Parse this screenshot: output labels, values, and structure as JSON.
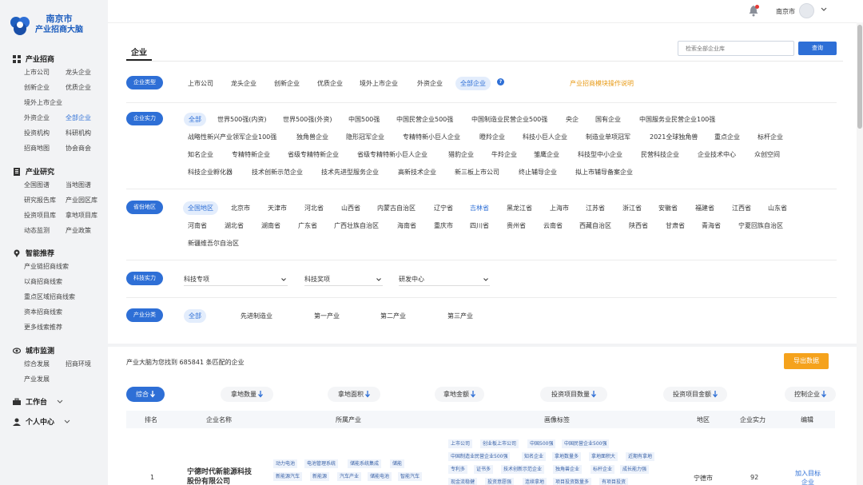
{
  "brand": {
    "line1": "南京市",
    "line2": "产业招商大脑"
  },
  "sidebar": {
    "sections": [
      {
        "title": "产业招商",
        "items": [
          "上市公司",
          "龙头企业",
          "创新企业",
          "优质企业",
          "境外上市企业",
          "外资企业",
          "全部企业",
          "投资机构",
          "科研机构",
          "招商地图",
          "协会商会"
        ]
      },
      {
        "title": "产业研究",
        "items": [
          "全国图谱",
          "当地图谱",
          "研究报告库",
          "产业园区库",
          "投资项目库",
          "拿地项目库",
          "动态监测",
          "产业政策"
        ]
      },
      {
        "title": "智能推荐",
        "items": [
          "产业链招商线索",
          "以商招商线索",
          "重点区域招商线索",
          "资本招商线索",
          "更多线索推荐"
        ]
      },
      {
        "title": "城市监测",
        "items": [
          "综合发展",
          "招商环境",
          "产业发展"
        ]
      },
      {
        "title": "工作台"
      },
      {
        "title": "个人中心"
      }
    ]
  },
  "topbar": {
    "city": "南京市"
  },
  "tab": {
    "label": "企业"
  },
  "search": {
    "placeholder": "检索全部企业库",
    "button": "查询"
  },
  "filters": {
    "type": {
      "label": "企业类型",
      "options": [
        "上市公司",
        "龙头企业",
        "创新企业",
        "优质企业",
        "境外上市企业",
        "外资企业",
        "全部企业"
      ],
      "guide": "产业招商模块操作说明"
    },
    "strength": {
      "label": "企业实力",
      "rows": [
        [
          "全部",
          "世界500强(内资)",
          "世界500强(外资)",
          "中国500强",
          "中国民营企业500强",
          "中国制造业民营企业500强",
          "央企",
          "国有企业",
          "中国服务业民营企业100强"
        ],
        [
          "战略性新兴产业领军企业100强",
          "独角兽企业",
          "隐形冠军企业",
          "专精特新小巨人企业",
          "瞪羚企业",
          "科技小巨人企业",
          "制造业单项冠军",
          "2021全球独角兽",
          "重点企业",
          "标杆企业"
        ],
        [
          "知名企业",
          "专精特新企业",
          "省级专精特新企业",
          "省级专精特新小巨人企业",
          "猎豹企业",
          "牛羚企业",
          "雏鹰企业",
          "科技型中小企业",
          "民营科技企业",
          "企业技术中心",
          "众创空间"
        ],
        [
          "科技企业孵化器",
          "技术创新示范企业",
          "技术先进型服务企业",
          "高新技术企业",
          "新三板上市公司",
          "终止辅导企业",
          "拟上市辅导备案企业"
        ]
      ]
    },
    "region": {
      "label": "省份地区",
      "rows": [
        [
          "全国地区",
          "北京市",
          "天津市",
          "河北省",
          "山西省",
          "内蒙古自治区",
          "辽宁省",
          "吉林省",
          "黑龙江省",
          "上海市",
          "江苏省",
          "浙江省",
          "安徽省",
          "福建省",
          "江西省",
          "山东省"
        ],
        [
          "河南省",
          "湖北省",
          "湖南省",
          "广东省",
          "广西壮族自治区",
          "海南省",
          "重庆市",
          "四川省",
          "贵州省",
          "云南省",
          "西藏自治区",
          "陕西省",
          "甘肃省",
          "青海省",
          "宁夏回族自治区"
        ],
        [
          "新疆维吾尔自治区"
        ]
      ]
    },
    "tech": {
      "label": "科技实力",
      "selects": [
        "科技专项",
        "科技奖项",
        "研发中心"
      ]
    },
    "industry": {
      "label": "产业分类",
      "options": [
        "全部",
        "先进制造业",
        "第一产业",
        "第二产业",
        "第三产业"
      ]
    }
  },
  "results": {
    "count_text": "产业大脑为您找到 685841 条匹配的企业",
    "export": "导出数据",
    "sorts": [
      "综合",
      "拿地数量",
      "拿地面积",
      "拿地金额",
      "投资项目数量",
      "投资项目金额",
      "控制企业"
    ],
    "columns": [
      "排名",
      "企业名称",
      "所属产业",
      "画像标签",
      "地区",
      "企业实力",
      "编辑"
    ],
    "rows": [
      {
        "rank": "1",
        "name": "宁德时代新能源科技股份有限公司",
        "industries": [
          "动力电池",
          "电池管理系统",
          "储能系统集成",
          "储能",
          "新能源汽车",
          "新能源",
          "汽车产业",
          "储能电池",
          "智能汽车"
        ],
        "tags": [
          "上市公司",
          "创业板上市公司",
          "中国500强",
          "中国民营企业500强",
          "中国制造业民营企业500强",
          "知名企业",
          "拿地数量多",
          "拿地面积大",
          "近期有拿地",
          "专利多",
          "证书多",
          "技术创新示范企业",
          "独角兽企业",
          "标杆企业",
          "成长能力强",
          "现金流稳健",
          "投资意愿强",
          "连续拿地",
          "项目投资数量多",
          "有项目投资"
        ],
        "region": "宁德市",
        "strength": "92",
        "edit": "加入目标企业"
      }
    ]
  }
}
